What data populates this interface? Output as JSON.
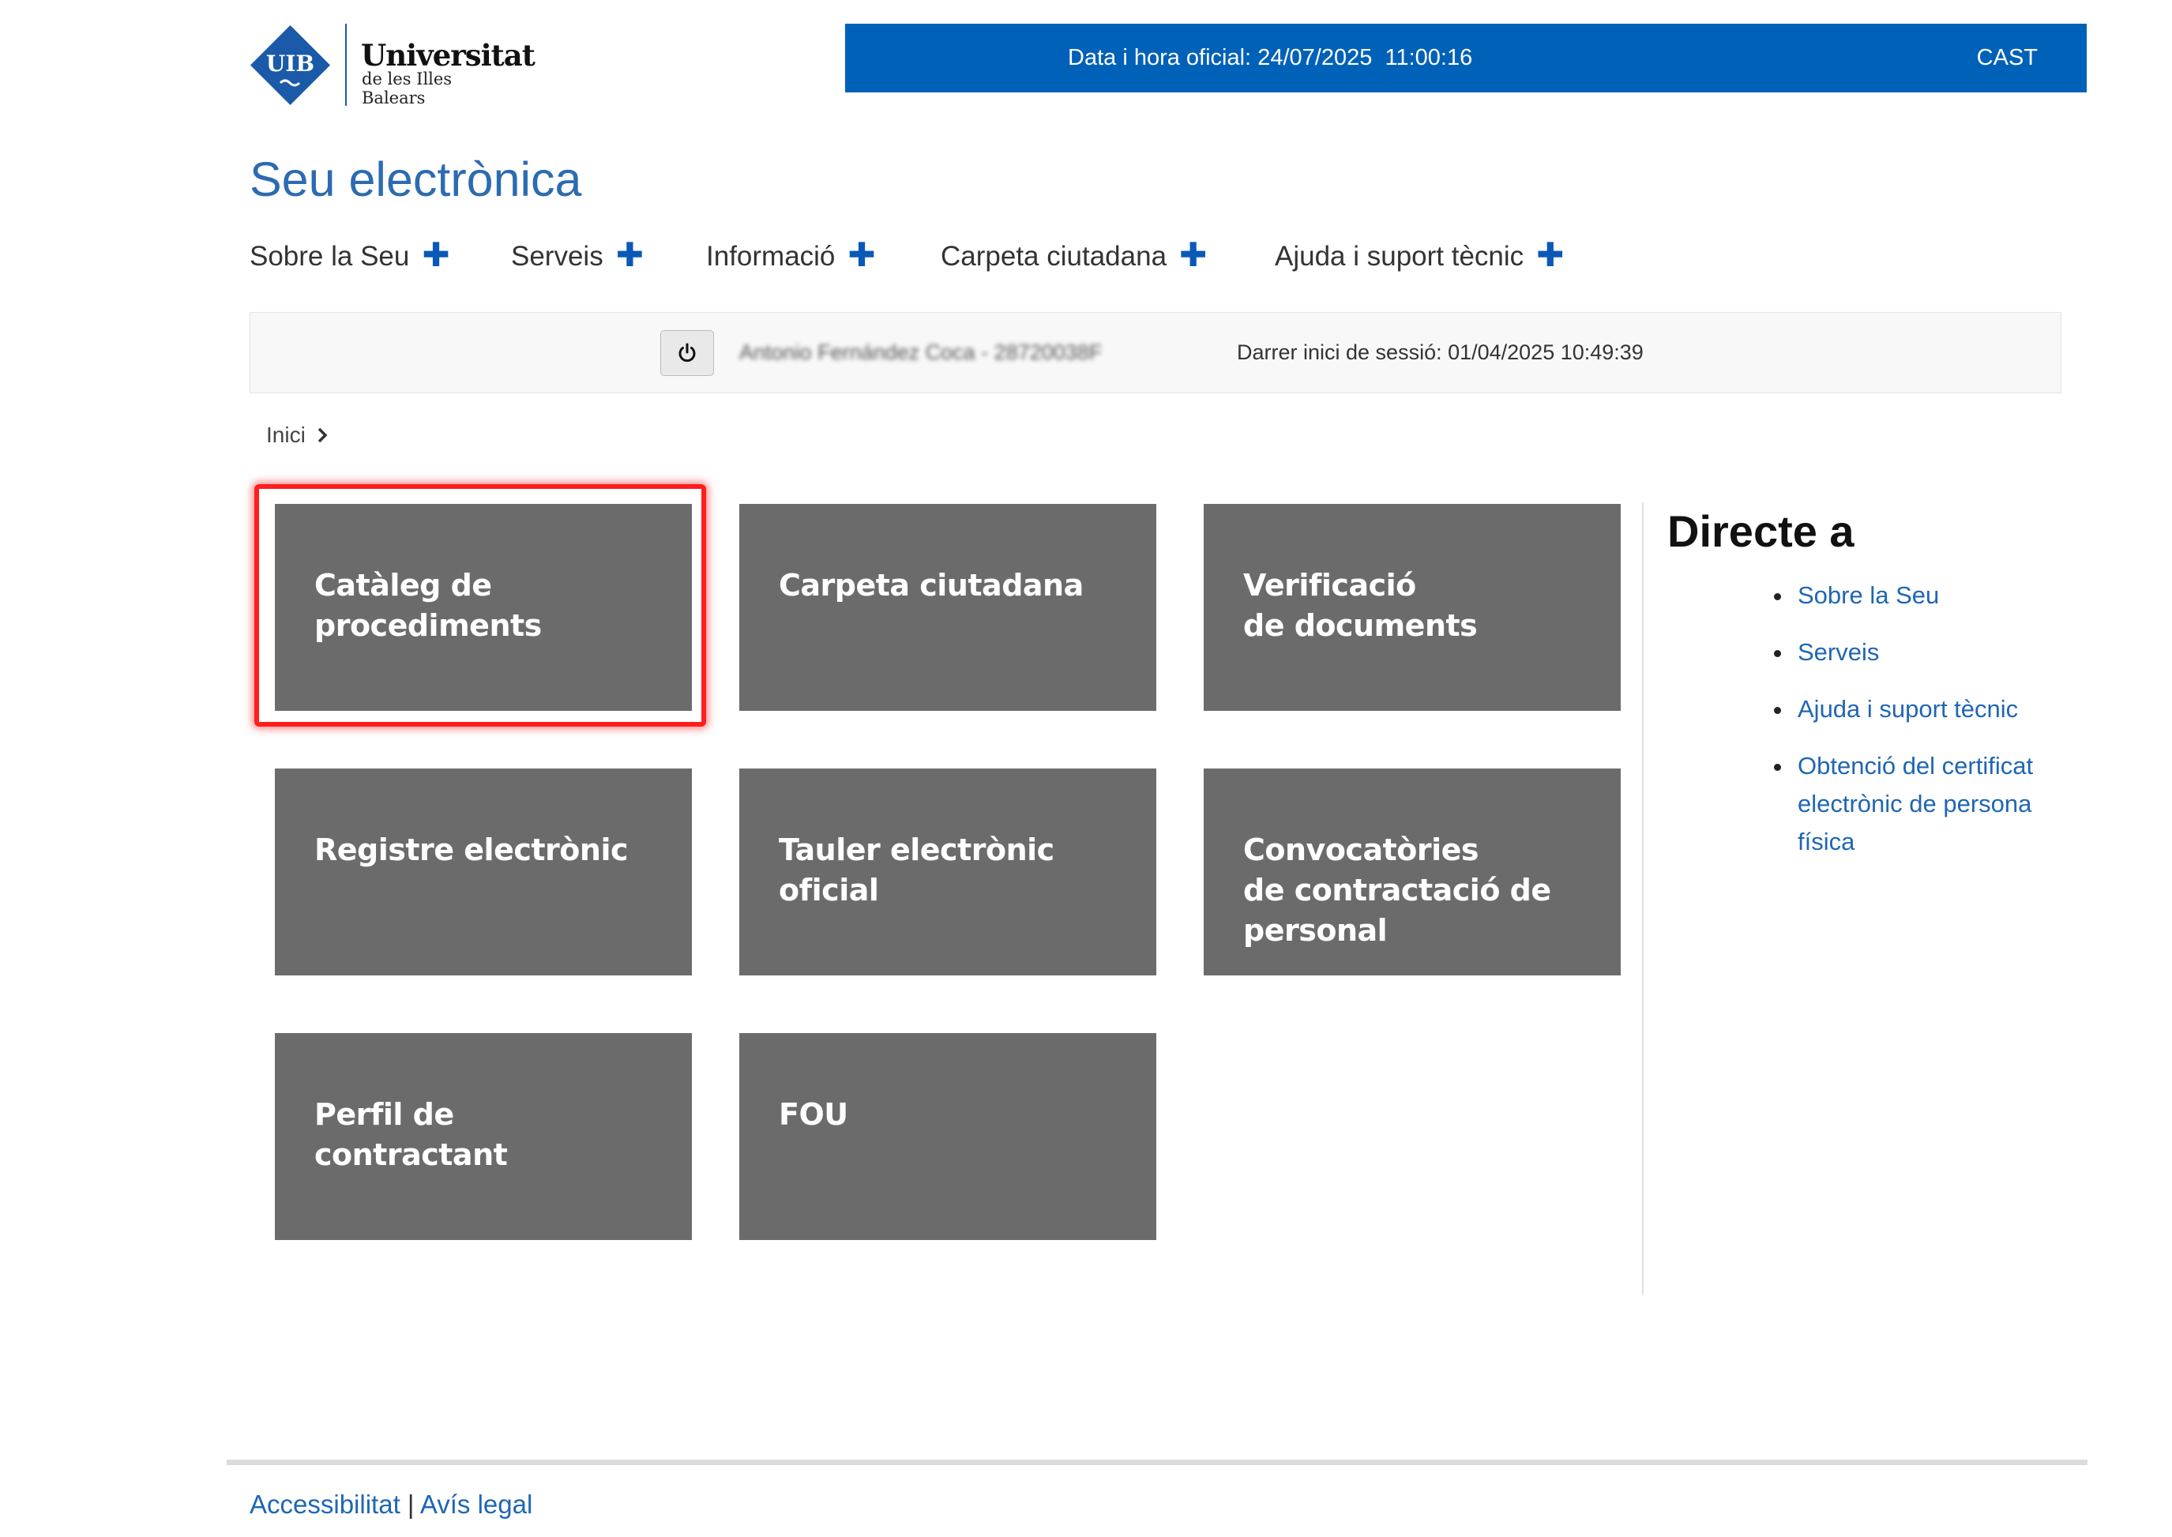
{
  "header": {
    "logo": {
      "abbr": "UIB",
      "name": "Universitat",
      "subtitle": "de les Illes Balears"
    },
    "datetime_label": "Data i hora oficial:",
    "date": "24/07/2025",
    "time": "11:00:16",
    "language_link": "CAST"
  },
  "site_title": "Seu electrònica",
  "nav": [
    {
      "label": "Sobre la Seu",
      "icon": "plus-icon"
    },
    {
      "label": "Serveis",
      "icon": "plus-icon"
    },
    {
      "label": "Informació",
      "icon": "plus-icon"
    },
    {
      "label": "Carpeta ciutadana",
      "icon": "plus-icon"
    },
    {
      "label": "Ajuda i suport tècnic",
      "icon": "plus-icon"
    }
  ],
  "session": {
    "logout_icon": "power-icon",
    "user": "Antonio Fernández Coca - 28720038F",
    "last_login": "Darrer inici de sessió: 01/04/2025 10:49:39"
  },
  "breadcrumb": {
    "home": "Inici",
    "icon": "chevron-right-icon"
  },
  "tiles": [
    {
      "lines": [
        "Catàleg de procediments"
      ],
      "highlighted": true
    },
    {
      "lines": [
        "Carpeta ciutadana"
      ]
    },
    {
      "lines": [
        "Verificació",
        "de documents"
      ]
    },
    {
      "lines": [
        "Registre electrònic"
      ]
    },
    {
      "lines": [
        "Tauler electrònic oficial"
      ]
    },
    {
      "lines": [
        "Convocatòries",
        "de contractació de",
        "personal"
      ]
    },
    {
      "lines": [
        "Perfil de contractant"
      ]
    },
    {
      "lines": [
        "FOU"
      ]
    }
  ],
  "sidebar": {
    "title": "Directe a",
    "links": [
      "Sobre la Seu",
      "Serveis",
      "Ajuda i suport tècnic",
      "Obtenció del certificat electrònic de persona física"
    ]
  },
  "footer": {
    "accessibility": "Accessibilitat",
    "separator": "|",
    "legal": "Avís legal"
  },
  "colors": {
    "brand_blue": "#0061b9",
    "title_blue": "#2c6bb0",
    "link_blue": "#1f66b3",
    "tile_gray": "#6b6b6b",
    "highlight_red": "#ff1e1e"
  }
}
